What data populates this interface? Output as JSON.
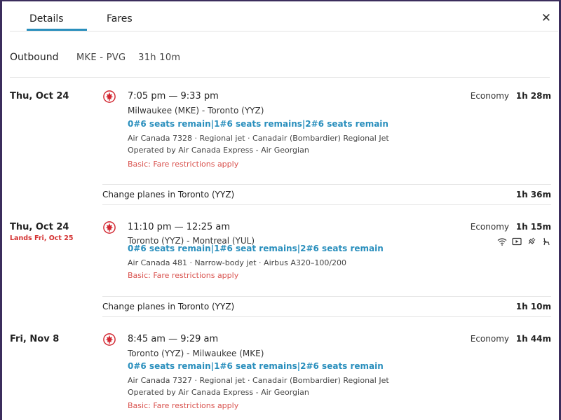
{
  "tabs": [
    {
      "label": "Details",
      "active": true
    },
    {
      "label": "Fares",
      "active": false
    }
  ],
  "close_icon": "close-icon",
  "outbound": {
    "label": "Outbound",
    "route": "MKE - PVG",
    "duration": "31h 10m"
  },
  "segments": [
    {
      "date": "Thu, Oct 24",
      "lands": "",
      "times": "7:05 pm — 9:33 pm",
      "route": "Milwaukee (MKE) - Toronto (YYZ)",
      "seats": "0#6 seats remain|1#6 seats remains|2#6 seats remain",
      "flight_info": "Air Canada 7328 · Regional jet · Canadair (Bombardier) Regional Jet",
      "operated": "Operated by Air Canada Express - Air Georgian",
      "fare_note": "Basic: Fare restrictions apply",
      "cabin": "Economy",
      "duration": "1h 28m"
    },
    {
      "date": "Thu, Oct 24",
      "lands": "Lands Fri, Oct 25",
      "times": "11:10 pm — 12:25 am",
      "route": "Toronto (YYZ) - Montreal (YUL)",
      "seats": "0#6 seats remain|1#6 seat remains|2#6 seats remain",
      "flight_info": "Air Canada 481 · Narrow-body jet · Airbus A320–100/200",
      "operated": "",
      "fare_note": "Basic: Fare restrictions apply",
      "cabin": "Economy",
      "duration": "1h 15m",
      "amenities": [
        "wifi-icon",
        "video-icon",
        "power-icon",
        "seat-icon"
      ]
    },
    {
      "date": "Fri, Nov 8",
      "lands": "",
      "times": "8:45 am — 9:29 am",
      "route": "Toronto (YYZ) - Milwaukee (MKE)",
      "seats": "0#6 seats remain|1#6 seat remains|2#6 seats remain",
      "flight_info": "Air Canada 7327 · Regional jet · Canadair (Bombardier) Regional Jet",
      "operated": "Operated by Air Canada Express - Air Georgian",
      "fare_note": "Basic: Fare restrictions apply",
      "cabin": "Economy",
      "duration": "1h 44m"
    }
  ],
  "layovers": [
    {
      "text": "Change planes in Toronto (YYZ)",
      "duration": "1h 36m"
    },
    {
      "text": "Change planes in Toronto (YYZ)",
      "duration": "1h 10m"
    }
  ],
  "colors": {
    "accent": "#2a8fbd",
    "warning": "#d9534f",
    "airline_red": "#d22630",
    "frame": "#3b2d5c"
  }
}
